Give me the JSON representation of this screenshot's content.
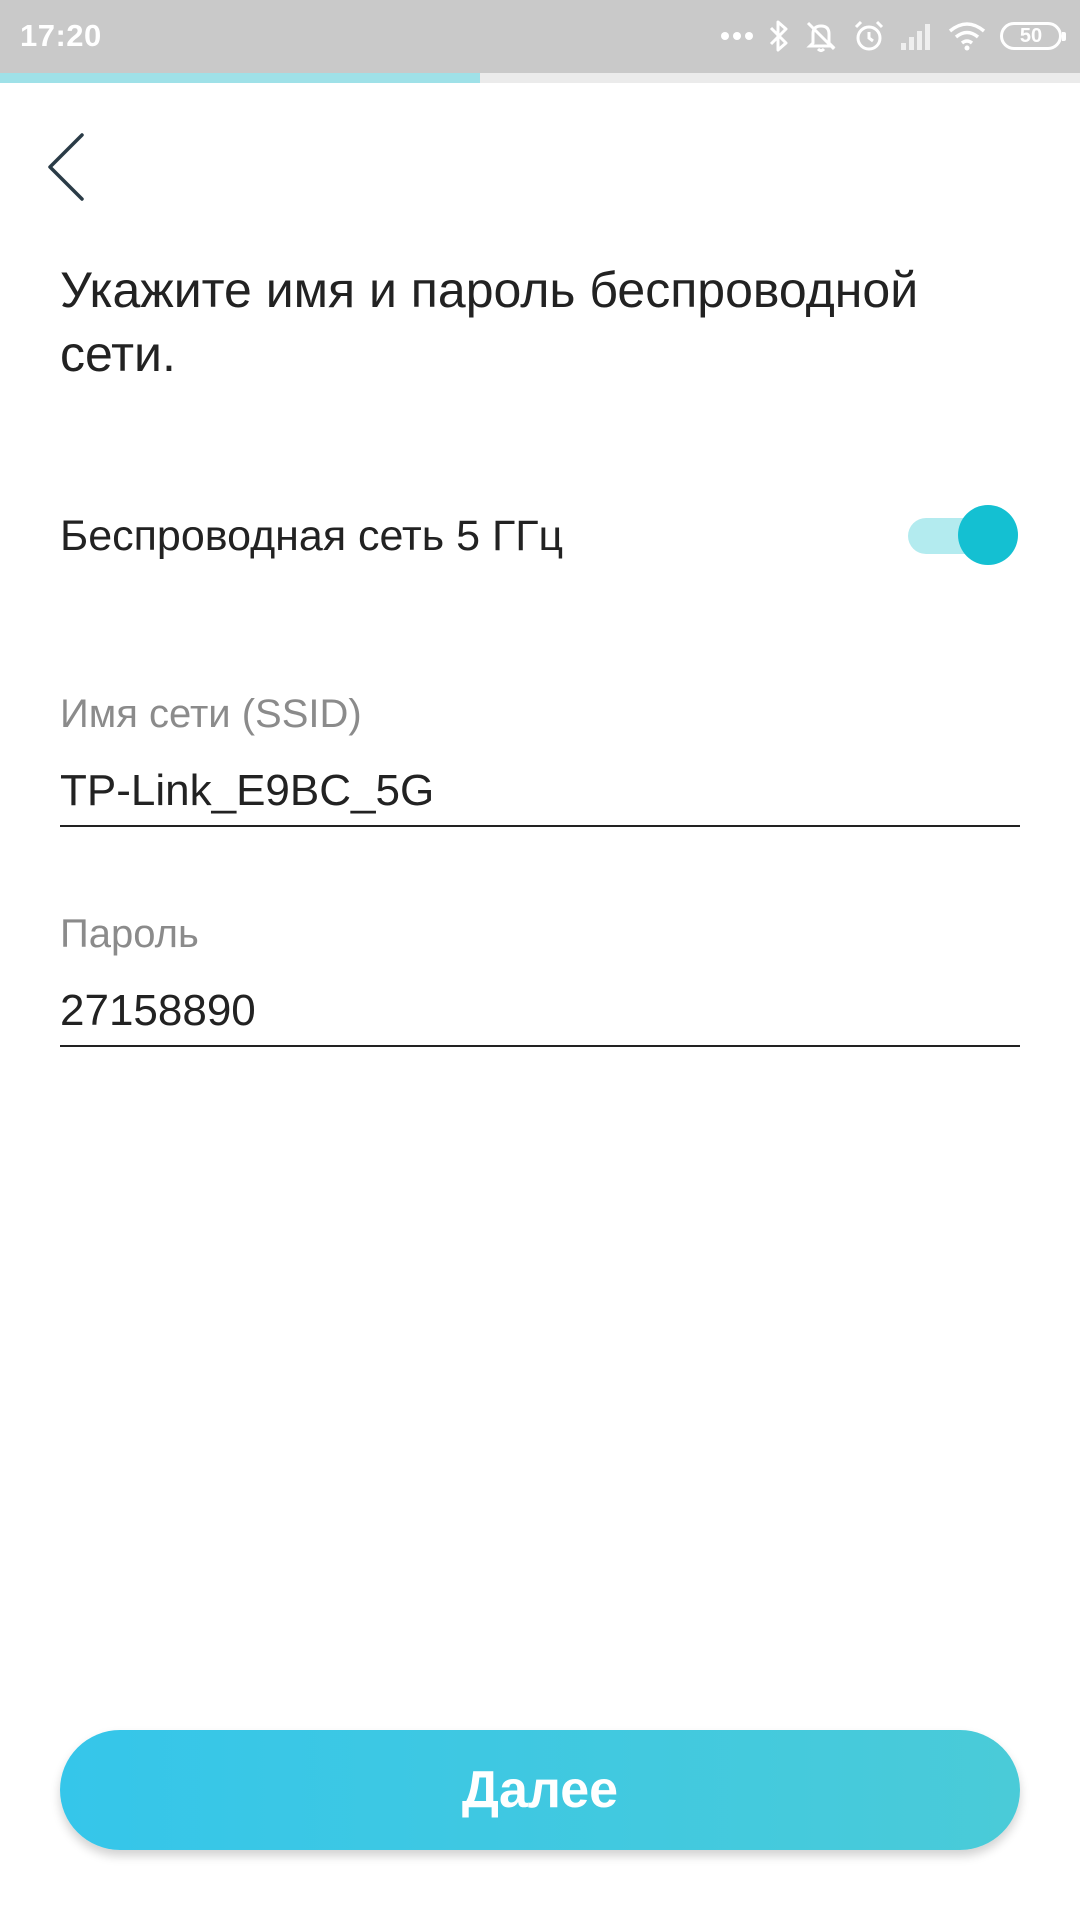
{
  "status_bar": {
    "time": "17:20",
    "battery": "50",
    "icons": [
      "more-dots-icon",
      "bluetooth-icon",
      "mute-icon",
      "alarm-icon",
      "signal-icon",
      "wifi-icon",
      "battery-icon"
    ]
  },
  "progress": {
    "fraction": 0.444,
    "fill_color": "#9fe1e8",
    "track_color": "#ebebeb"
  },
  "header": {
    "back_icon": "chevron-left-icon",
    "title": "Укажите имя и пароль беспроводной сети."
  },
  "wireless_5ghz": {
    "label": "Беспроводная сеть 5 ГГц",
    "enabled": true,
    "accent_color": "#14c0d2"
  },
  "ssid": {
    "label": "Имя сети (SSID)",
    "value": "TP-Link_E9BC_5G"
  },
  "password": {
    "label": "Пароль",
    "value": "27158890"
  },
  "actions": {
    "next_label": "Далее"
  }
}
